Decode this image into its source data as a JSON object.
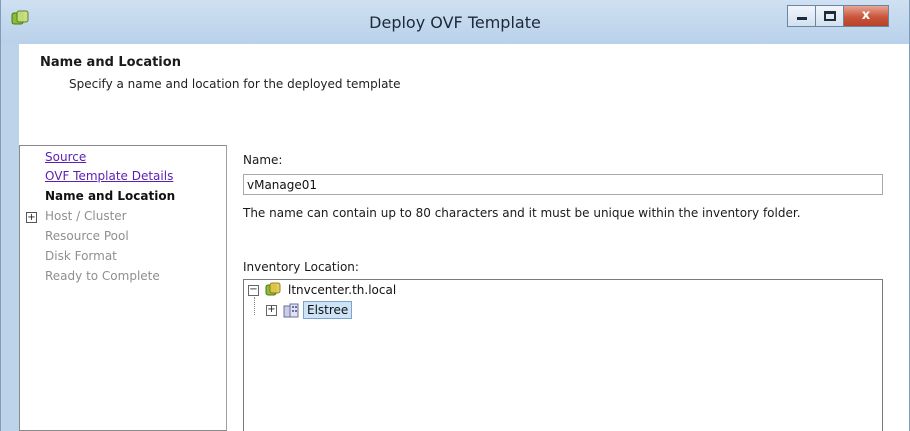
{
  "window": {
    "title": "Deploy OVF Template",
    "close_glyph": "x",
    "icons": {
      "app": "vsphere-app-icon",
      "minimize": "minimize-icon",
      "maximize": "maximize-icon",
      "close": "close-icon"
    }
  },
  "header": {
    "title": "Name and Location",
    "subtitle": "Specify a name and location for the deployed template"
  },
  "nav": {
    "items": [
      {
        "label": "Source",
        "state": "link"
      },
      {
        "label": "OVF Template Details",
        "state": "link"
      },
      {
        "label": "Name and Location",
        "state": "current"
      },
      {
        "label": "Host / Cluster",
        "state": "disabled",
        "expander": "+"
      },
      {
        "label": "Resource Pool",
        "state": "disabled"
      },
      {
        "label": "Disk Format",
        "state": "disabled"
      },
      {
        "label": "Ready to Complete",
        "state": "disabled"
      }
    ]
  },
  "form": {
    "name_label": "Name:",
    "name_value": "vManage01",
    "hint": "The name can contain up to 80 characters and it must be unique within the inventory folder.",
    "inventory_label": "Inventory Location:"
  },
  "tree": {
    "root": {
      "label": "ltnvcenter.th.local",
      "toggle": "−",
      "icon": "vcenter-icon"
    },
    "child": {
      "label": "Elstree",
      "toggle": "+",
      "icon": "datacenter-icon",
      "selected": true
    }
  },
  "colors": {
    "window_chrome": "#bcd3ea",
    "link": "#5a1fb3",
    "close_button": "#c9553c",
    "selection": "#cde4f7"
  }
}
